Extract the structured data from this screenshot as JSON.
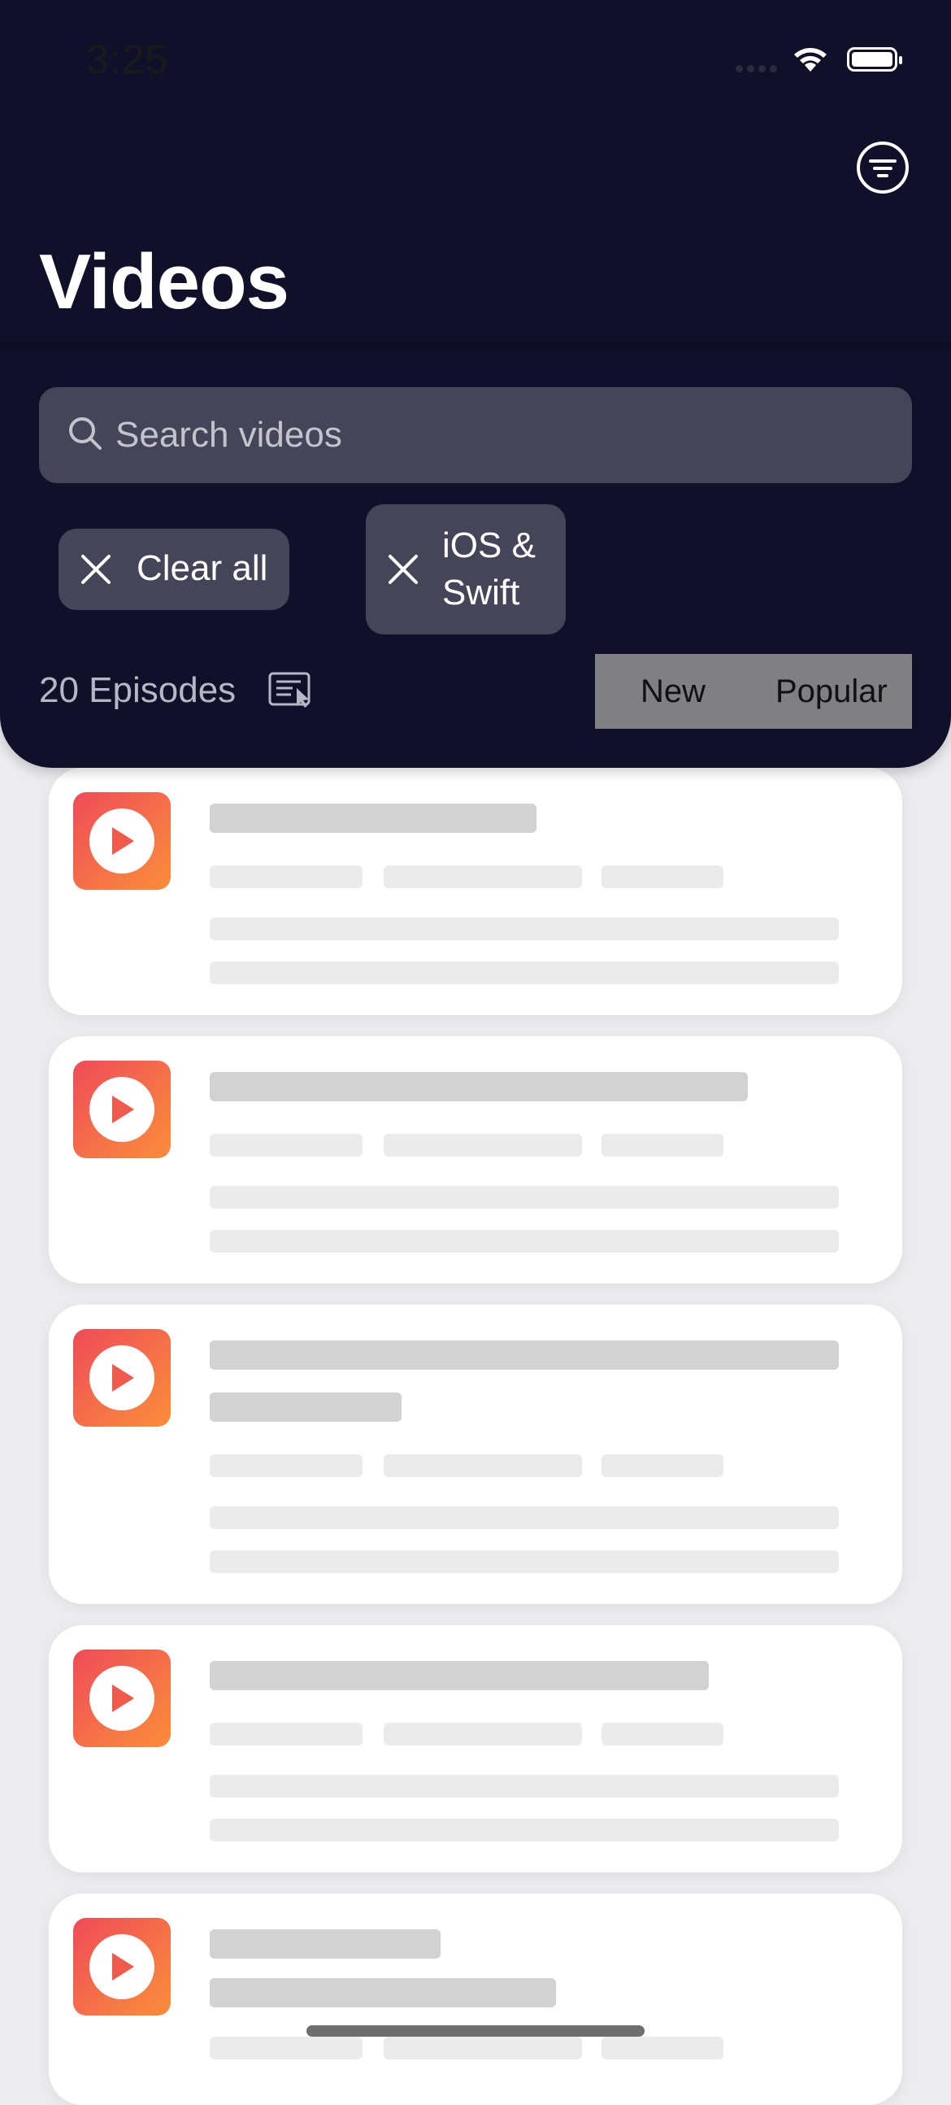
{
  "status_bar": {
    "time": "3:25"
  },
  "header": {
    "title": "Videos",
    "search_placeholder": "Search videos",
    "chips": [
      {
        "label": "Clear all"
      },
      {
        "label": "iOS & Swift"
      }
    ],
    "episode_count": "20 Episodes",
    "sort_options": [
      "New",
      "Popular"
    ]
  },
  "icons": {
    "filter": "filter-icon",
    "search": "search-icon",
    "close": "close-icon",
    "downloads": "download-list-icon",
    "play": "play-icon"
  },
  "colors": {
    "header_bg": "#10102b",
    "search_bg": "#464458",
    "chip_bg": "#45455a",
    "thumb_gradient_start": "#ef4a58",
    "thumb_gradient_end": "#fb8c3a",
    "skeleton_title": "#d2d2d2",
    "skeleton_line": "#ebebeb"
  }
}
